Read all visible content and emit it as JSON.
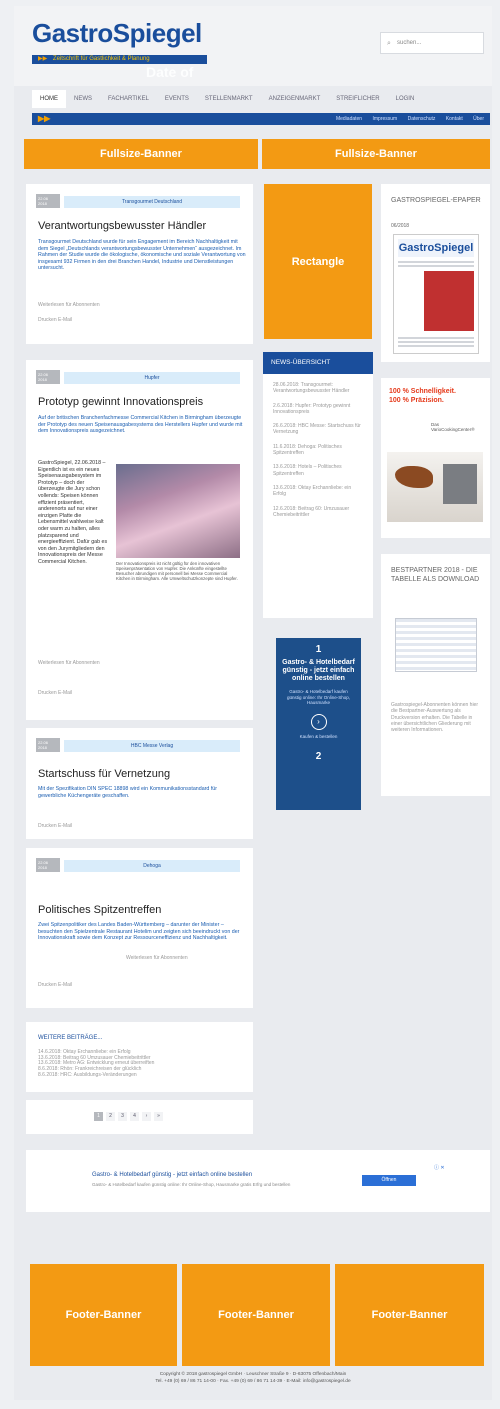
{
  "header": {
    "logo": "GastroSpiegel",
    "tagline": "Zeitschrift für Gastlichkeit & Planung",
    "watermark": "Date of",
    "search_placeholder": "suchen..."
  },
  "nav": [
    "HOME",
    "NEWS",
    "FACHARTIKEL",
    "EVENTS",
    "STELLENMARKT",
    "ANZEIGENMARKT",
    "STREIFLICHER",
    "LOGIN"
  ],
  "blue_bar": {
    "arrows": "▶▶",
    "links": [
      "Mediadaten",
      "Impressum",
      "Datenschutz",
      "Kontakt",
      "Über"
    ]
  },
  "banners": {
    "top_left": "Fullsize-Banner",
    "top_right": "Fullsize-Banner",
    "rectangle": "Rectangle",
    "footer": [
      "Footer-Banner",
      "Footer-Banner",
      "Footer-Banner"
    ]
  },
  "articles": [
    {
      "date": "22.06 2018",
      "tag": "Transgourmet Deutschland",
      "title": "Verantwortungsbewusster Händler",
      "teaser": "Transgourmet Deutschland wurde für sein Engagement im Bereich Nachhaltigkeit mit dem Siegel „Deutschlands verantwortungsbewusster Unternehmen“ ausgezeichnet. Im Rahmen der Studie wurde die ökologische, ökonomische und soziale Verantwortung von insgesamt 932 Firmen in den drei Branchen Handel, Industrie und Dienstleistungen untersucht.",
      "source": "Weiterlesen für Abonnenten",
      "actions": "Drucken   E-Mail"
    },
    {
      "date": "22.06 2018",
      "tag": "Hupfer",
      "title": "Prototyp gewinnt Innovationspreis",
      "teaser": "Auf der britischen Branchenfachmesse Commercial Kitchen in Birmingham überzeugte der Prototyp des neuen Speisenausgabesystems des Herstellers Hupfer und wurde mit dem Innovationspreis ausgezeichnet.",
      "body": "GastroSpiegel, 22.06.2018 – Eigentlich ist es ein neues Speisenausgabesystem im Prototyp – doch der überzeugte die Jury schon vollends: Speisen können effizient präsentiert, anderenorts auf nur einer einzigen Platte die Lebensmittel wahlweise kalt oder warm zu halten, alles platzsparend und energieeffizient. Dafür gab es von den Jurymitgliedern den Innovationspreis der Messe Commercial Kitchen.",
      "caption": "Der Innovationspreis ist nicht gültig für den innovativen Speisenpräsentation von Hupfer. Die Ankünfte eingestellte Besucher abrundigen mit personell bei Messe Commercial Kitchen in Birmingham. Alle Umweltschutzkonzepte sind Hupfer.",
      "source": "Weiterlesen für Abonnenten",
      "actions": "Drucken   E-Mail"
    },
    {
      "date": "22.06 2018",
      "tag": "HBC Messe Verlag",
      "title": "Startschuss für Vernetzung",
      "teaser": "Mit der Spezifikation DIN SPEC 18898 wird ein Kommunikationsstandard für gewerbliche Küchengeräte geschaffen.",
      "actions": "Drucken   E-Mail"
    },
    {
      "date": "22.06 2018",
      "tag": "Dehoga",
      "title": "Politisches Spitzentreffen",
      "teaser": "Zwei Spitzenpolitiker des Landes Baden-Württemberg – darunter der Minister – besuchten den Spielzentrale Restaurant Hotelim und zeigten sich beeindruckt von der Innovationskraft sowie dem Konzept zur Ressourceneffizienz und Nachhaltigkeit.",
      "source": "Weiterlesen für Abonnenten",
      "actions": "Drucken   E-Mail"
    }
  ],
  "more": {
    "title": "WEITERE BEITRÄGE...",
    "items": [
      "14.6.2018: Oktay Erchannliebe: ein Erfolg",
      "13.6.2018: Beitrag 60 Umzusauer Chemiebeitrittler",
      "13.6.2018: Metro AG: Entwicklung erneut überreiften",
      "8.6.2018: Rhön: Frankreichreisen der glücklich",
      "8.6.2018: HRC: Ausbildungs-Veränderungen"
    ]
  },
  "pagination": [
    "1",
    "2",
    "3",
    "4",
    "›",
    "»"
  ],
  "news": {
    "title": "NEWS-ÜBERSICHT",
    "items": [
      "28.06.2018: Transgourmet: Verantwortungsbewusster Händler",
      "2.6.2018: Hupfer: Prototyp gewinnt Innovationspreis",
      "26.6.2018: HBC Messe: Startschuss für Vernetzung",
      "11.6.2018: Dehoga: Politisches Spitzentreffen",
      "13.6.2018: Hotels – Politisches Spitzentreffen",
      "13.6.2018: Oktay Erchannliebe: ein Erfolg",
      "12.6.2018: Beitrag 60: Umzusauer Chemiebeitrittler"
    ]
  },
  "epaper": {
    "title": "GASTROSPIEGEL-EPAPER",
    "issue": "06/2018",
    "cover_logo": "GastroSpiegel"
  },
  "sidead": {
    "headline1": "100 % Schnelligkeit.",
    "headline2": "100 % Präzision.",
    "sub": "Das VarioCookingCenter®"
  },
  "bestpartner": {
    "title": "BESTPARTNER 2018 - DIE TABELLE ALS DOWNLOAD",
    "text": "Gastrospiegel-Abonnenten können hier die Bestpartner-Auswertung als Druckversion erhalten. Die Tabelle in einer übersichtlichen Gliederung mit weiteren Informationen."
  },
  "blue_ad": {
    "num1": "1",
    "title": "Gastro- & Hotelbedarf günstig - jetzt einfach online bestellen",
    "sub": "Gastro- & Hotelbedarf kaufen günstig online: Ihr Online-Shop, Hausmarke",
    "arrow": "›",
    "small": "Kaufen & bestellen",
    "num2": "2"
  },
  "text_ad": {
    "title": "Gastro- & Hotelbedarf günstig - jetzt einfach online bestellen",
    "sub": "Gastro- & Hotelbedarf kaufen günstig online: Ihr Online-Shop, Hausmarke gratis Erfrg und bestellen",
    "button": "Öffnen",
    "badge": "ⓘ ✕"
  },
  "footer": {
    "line1": "Copyright © 2018 gastrospiegel GmbH · Leuschner Straße 9 · D-63075 Offenbach/Main",
    "line2": "Tel. +49 (0) 69 / 86 71 14-00 · Fax. +49 (0) 69 / 86 71 14-39 · E-Mail: info@gastrospiegel.de"
  },
  "colors": {
    "brand_blue": "#1a4e9c",
    "banner_orange": "#f39a13"
  }
}
